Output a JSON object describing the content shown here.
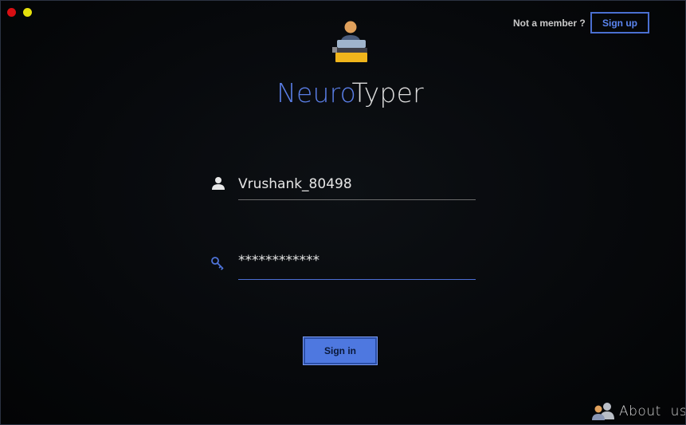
{
  "header": {
    "member_prompt": "Not a member ?",
    "signup_label": "Sign up"
  },
  "brand": {
    "name_part1": "Neuro",
    "name_part2": "Typer",
    "logo_icon": "person-typing-icon",
    "accent_color": "#5a7ee6"
  },
  "login": {
    "username_icon": "user-icon",
    "username_value": "Vrushank_80498",
    "password_icon": "key-icon",
    "password_value": "************",
    "signin_label": "Sign in"
  },
  "footer": {
    "about_icon": "people-icon",
    "about_label": "About  us"
  },
  "window_controls": {
    "close_color": "#d80f13",
    "minimize_color": "#e5e00c"
  }
}
